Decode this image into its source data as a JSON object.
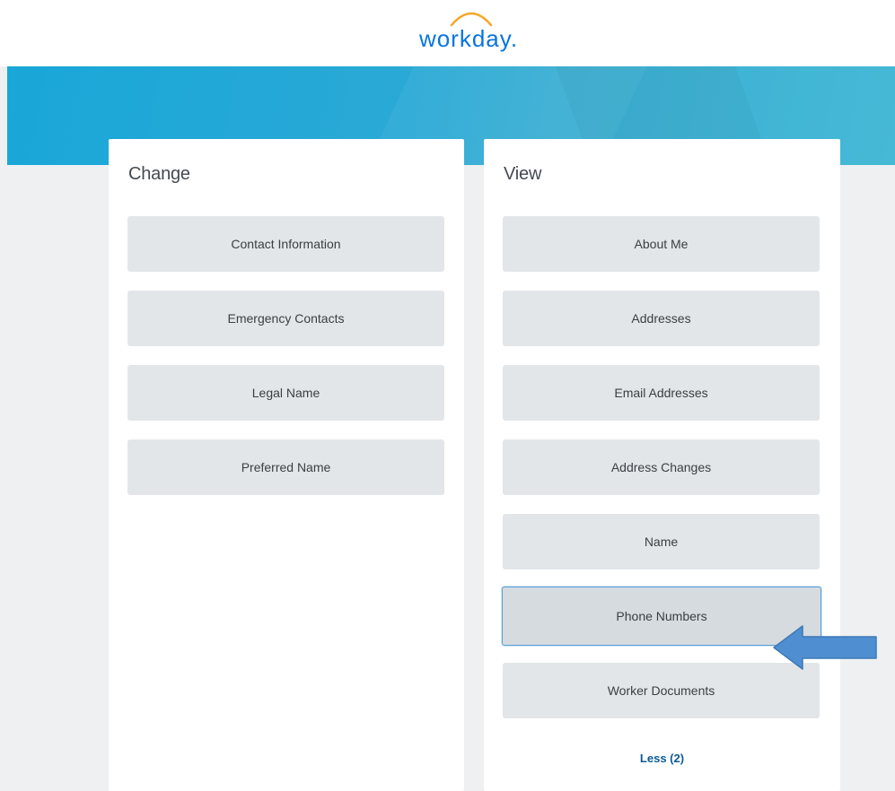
{
  "header": {
    "logo_text": "workday.",
    "logo_arc_color": "#f5a623",
    "logo_text_color": "#0875e1"
  },
  "change": {
    "title": "Change",
    "items": [
      {
        "label": "Contact Information"
      },
      {
        "label": "Emergency Contacts"
      },
      {
        "label": "Legal Name"
      },
      {
        "label": "Preferred Name"
      }
    ]
  },
  "view": {
    "title": "View",
    "items": [
      {
        "label": "About Me"
      },
      {
        "label": "Addresses"
      },
      {
        "label": "Email Addresses"
      },
      {
        "label": "Address Changes"
      },
      {
        "label": "Name"
      },
      {
        "label": "Phone Numbers",
        "selected": true
      },
      {
        "label": "Worker Documents"
      }
    ],
    "less_link": "Less (2)"
  },
  "annotation": {
    "icon": "left-arrow-icon",
    "color": "#4f8fd1"
  },
  "colors": {
    "banner": "#19a7d8",
    "tile": "#e2e6e9",
    "link": "#0b5a97"
  }
}
